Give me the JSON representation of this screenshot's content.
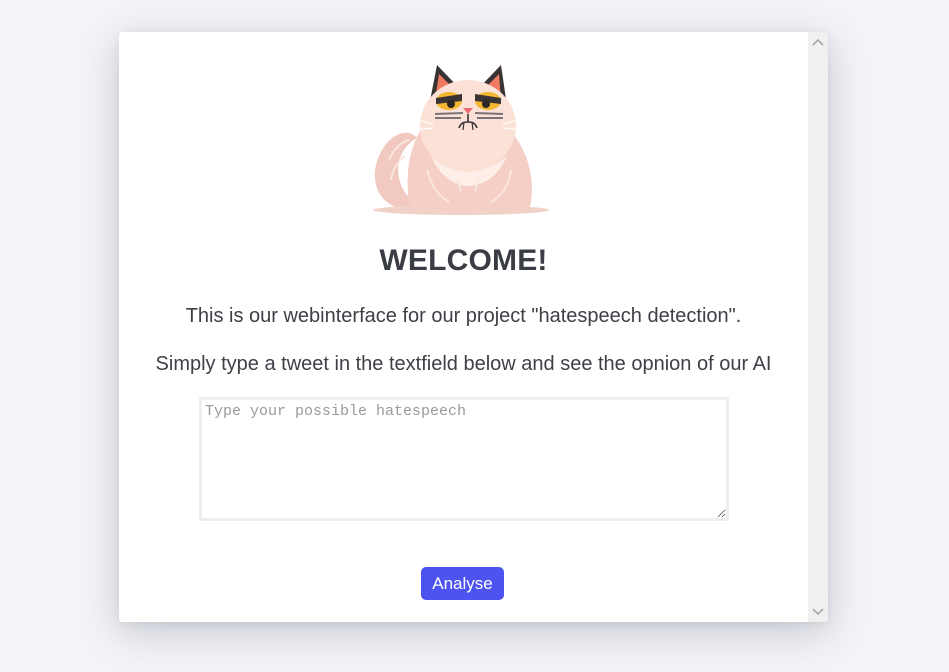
{
  "welcome": {
    "title": "WELCOME!",
    "intro_line": "This is our webinterface for our project \"hatespeech detection\".",
    "instruction_line": "Simply type a tweet in the textfield below and see the opnion of our AI"
  },
  "tweet_input": {
    "placeholder": "Type your possible hatespeech",
    "value": ""
  },
  "analyse_button": {
    "label": "Analyse"
  },
  "mascot": {
    "icon": "grumpy-cat-icon"
  },
  "colors": {
    "button": "#4c53ee",
    "text": "#3e4048",
    "background": "#f3f4f8"
  }
}
